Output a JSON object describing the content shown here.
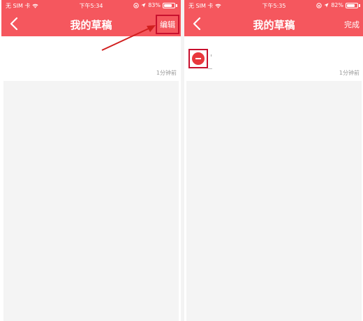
{
  "left_screen": {
    "status": {
      "carrier": "无 SIM 卡",
      "time": "下午5:34",
      "battery_percent": "83%",
      "battery_level": 0.83
    },
    "nav": {
      "title": "我的草稿",
      "action_label": "编辑"
    },
    "draft": {
      "time_ago": "1分钟前"
    }
  },
  "right_screen": {
    "status": {
      "carrier": "无 SIM 卡",
      "time": "下午5:35",
      "battery_percent": "82%",
      "battery_level": 0.82
    },
    "nav": {
      "title": "我的草稿",
      "action_label": "完成"
    },
    "draft": {
      "time_ago": "1分钟前"
    }
  },
  "colors": {
    "header": "#f5575e",
    "highlight_box": "#c8102e",
    "delete": "#e8383d",
    "preview_bg": "#f4f4f4"
  },
  "icons": [
    "back-chevron-icon",
    "wifi-icon",
    "location-arrow-icon",
    "lock-rotation-icon",
    "battery-icon",
    "delete-circle-icon"
  ]
}
